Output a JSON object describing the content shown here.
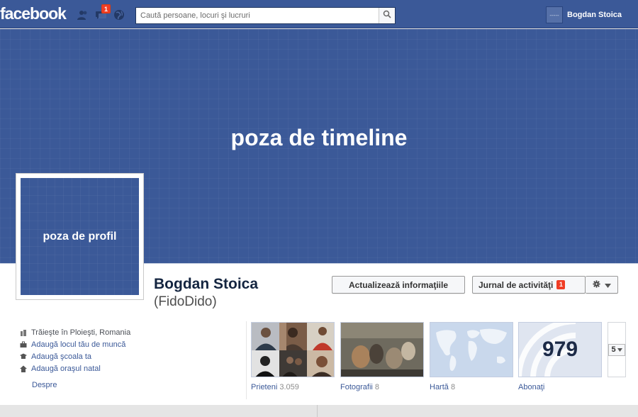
{
  "topbar": {
    "logo": "facebook",
    "notifications_count": "1",
    "search_placeholder": "Caută persoane, locuri şi lucruri",
    "user_name": "Bogdan Stoica",
    "user_thumb_text": "-----"
  },
  "cover": {
    "text": "poza de timeline"
  },
  "profile": {
    "picture_text": "poza de profil",
    "name": "Bogdan Stoica",
    "nickname": "(FidoDido)"
  },
  "actions": {
    "update_info": "Actualizează informaţiile",
    "activity_log": "Jurnal de activităţi",
    "activity_log_count": "1"
  },
  "info": {
    "items": [
      {
        "icon": "home-icon",
        "label": "Trăieşte în Ploieşti, Romania"
      },
      {
        "icon": "briefcase-icon",
        "label": "Adaugă locul tău de muncă"
      },
      {
        "icon": "school-icon",
        "label": "Adaugă şcoala ta"
      },
      {
        "icon": "house-icon",
        "label": "Adaugă oraşul natal"
      }
    ],
    "about": "Despre"
  },
  "tiles": {
    "friends": {
      "label": "Prieteni",
      "count": "3.059"
    },
    "photos": {
      "label": "Fotografii",
      "count": "8"
    },
    "map": {
      "label": "Hartă",
      "count": "8"
    },
    "subscribers": {
      "label": "Abonaţi",
      "count": "979"
    },
    "more": "5"
  },
  "colors": {
    "brand_blue": "#3b5998",
    "topbar_border": "#29447e",
    "badge_red": "#f03d25"
  }
}
